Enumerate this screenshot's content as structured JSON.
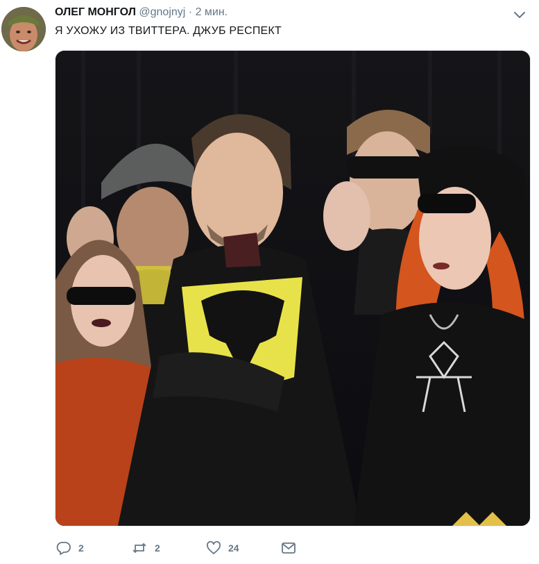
{
  "tweet": {
    "author_name": "ОЛЕГ МОНГОЛ",
    "author_handle": "@gnojnyj",
    "separator": "·",
    "time": "2 мин.",
    "text": "Я УХОЖУ ИЗ ТВИТТЕРА. ДЖУБ РЕСПЕКТ"
  },
  "actions": {
    "replies": "2",
    "retweets": "2",
    "likes": "24"
  },
  "icons": [
    "reply-icon",
    "retweet-icon",
    "like-icon",
    "direct-message-icon",
    "caret-down-icon"
  ],
  "colors": {
    "text": "#14171a",
    "secondary": "#657786",
    "background": "#ffffff"
  }
}
